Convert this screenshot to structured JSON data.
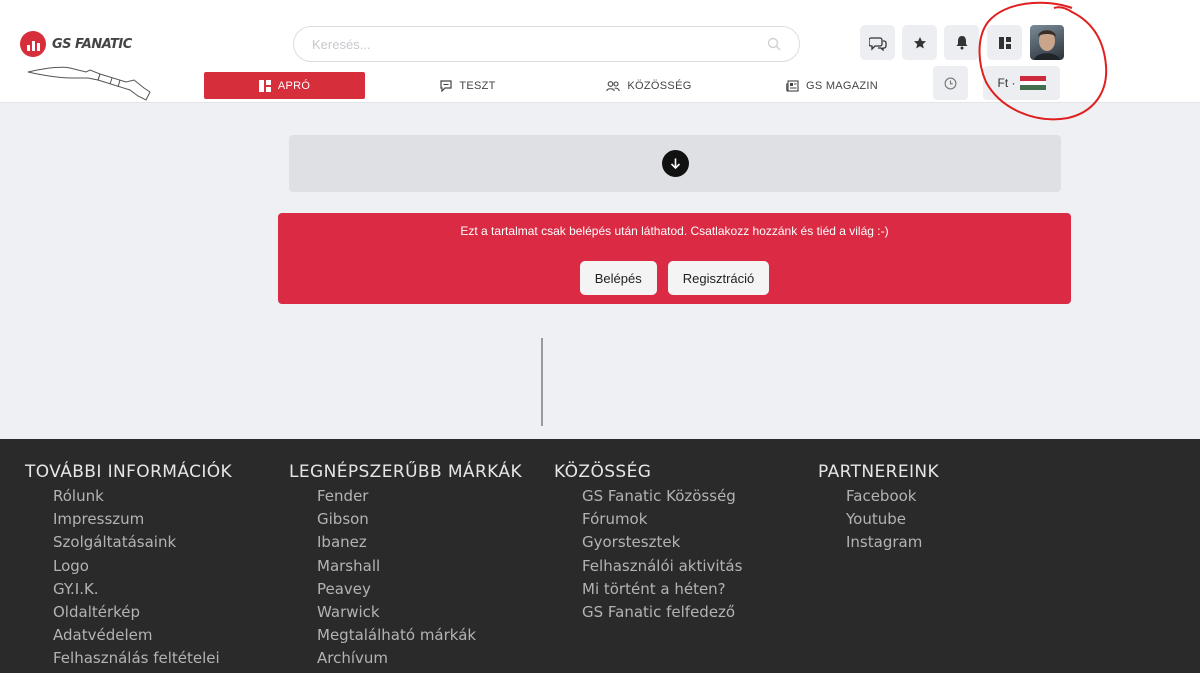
{
  "brand": {
    "logo_text": "GS FANATIC",
    "accent": "#d62e3a"
  },
  "search": {
    "placeholder": "Keresés..."
  },
  "header_icons": [
    "chat-icon",
    "star-icon",
    "bell-icon",
    "dashboard-icon",
    "avatar"
  ],
  "nav": {
    "items": [
      {
        "label": "APRÓ",
        "icon": "grid-icon",
        "active": true
      },
      {
        "label": "TESZT",
        "icon": "comment-icon",
        "active": false
      },
      {
        "label": "KÖZÖSSÉG",
        "icon": "users-icon",
        "active": false
      },
      {
        "label": "GS MAGAZIN",
        "icon": "newspaper-icon",
        "active": false
      }
    ],
    "currency": "Ft ·",
    "flag_colors": [
      "#cd2a3e",
      "#ffffff",
      "#436f4d"
    ]
  },
  "login_prompt": {
    "message": "Ezt a tartalmat csak belépés után láthatod. Csatlakozz hozzánk és tiéd a világ :-)",
    "login_label": "Belépés",
    "register_label": "Regisztráció",
    "color": "#db2a44"
  },
  "footer": {
    "columns": [
      {
        "heading": "TOVÁBBI INFORMÁCIÓK",
        "links": [
          "Rólunk",
          "Impresszum",
          "Szolgáltatásaink",
          "Logo",
          "GY.I.K.",
          "Oldaltérkép",
          "Adatvédelem",
          "Felhasználás feltételei"
        ]
      },
      {
        "heading": "LEGNÉPSZERŰBB MÁRKÁK",
        "links": [
          "Fender",
          "Gibson",
          "Ibanez",
          "Marshall",
          "Peavey",
          "Warwick",
          "Megtalálható márkák",
          "Archívum"
        ]
      },
      {
        "heading": "KÖZÖSSÉG",
        "links": [
          "GS Fanatic Közösség",
          "Fórumok",
          "Gyorstesztek",
          "Felhasználói aktivitás",
          "Mi történt a héten?",
          "GS Fanatic felfedező"
        ]
      },
      {
        "heading": "PARTNEREINK",
        "links": [
          "Facebook",
          "Youtube",
          "Instagram"
        ]
      }
    ]
  }
}
